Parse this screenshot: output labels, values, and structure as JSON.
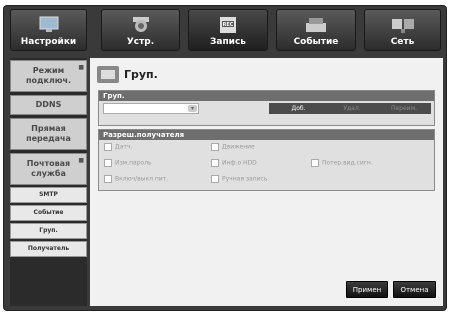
{
  "tabs": [
    {
      "label": "Настройки",
      "icon": "monitor-icon"
    },
    {
      "label": "Устр.",
      "icon": "camera-icon"
    },
    {
      "label": "Запись",
      "icon": "rec-icon"
    },
    {
      "label": "Событие",
      "icon": "event-icon"
    },
    {
      "label": "Сеть",
      "icon": "network-icon"
    }
  ],
  "sidebar": {
    "items": [
      {
        "label": "Режим подключ."
      },
      {
        "label": "DDNS"
      },
      {
        "label": "Прямая передача"
      },
      {
        "label": "Почтовая служба"
      }
    ],
    "subitems": [
      "SMTP",
      "Событие",
      "Груп.",
      "Получатель"
    ]
  },
  "page": {
    "title": "Груп.",
    "group_panel": {
      "header": "Груп.",
      "select_value": "",
      "add_label": "Доб.",
      "delete_label": "Удал.",
      "rename_label": "Переим."
    },
    "permission_panel": {
      "header": "Разреш.получателя",
      "options": [
        "Датч.",
        "Движение",
        "Изм.пароль",
        "Инф.о HDD",
        "Потер.вид.сигн.",
        "Включ/выкл пит.",
        "Ручная запись"
      ]
    },
    "apply_label": "Примен",
    "cancel_label": "Отмена"
  }
}
